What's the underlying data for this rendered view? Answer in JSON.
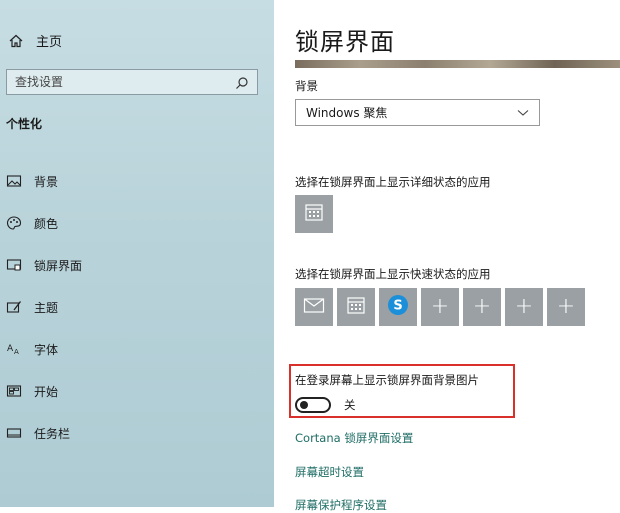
{
  "sidebar": {
    "home_label": "主页",
    "search_placeholder": "查找设置",
    "section_title": "个性化",
    "items": [
      {
        "label": "背景",
        "icon": "image-icon"
      },
      {
        "label": "颜色",
        "icon": "palette-icon"
      },
      {
        "label": "锁屏界面",
        "icon": "lock-screen-icon"
      },
      {
        "label": "主题",
        "icon": "theme-icon"
      },
      {
        "label": "字体",
        "icon": "font-icon"
      },
      {
        "label": "开始",
        "icon": "start-icon"
      },
      {
        "label": "任务栏",
        "icon": "taskbar-icon"
      }
    ]
  },
  "main": {
    "title": "锁屏界面",
    "background_label": "背景",
    "background_value": "Windows 聚焦",
    "detail_app_label": "选择在锁屏界面上显示详细状态的应用",
    "quick_app_label": "选择在锁屏界面上显示快速状态的应用",
    "quick_apps": [
      "mail-icon",
      "calendar-icon",
      "skype-icon",
      "plus-icon",
      "plus-icon",
      "plus-icon",
      "plus-icon"
    ],
    "signin_bg_label": "在登录屏幕上显示锁屏界面背景图片",
    "signin_bg_state": "关",
    "links": {
      "cortana": "Cortana 锁屏界面设置",
      "timeout": "屏幕超时设置",
      "screensaver": "屏幕保护程序设置"
    }
  },
  "colors": {
    "sidebar_bg": "#b9d3da",
    "tile_bg": "#9aa0a3",
    "link": "#1f6e66",
    "highlight": "#d9302c",
    "skype": "#1b8fd9"
  }
}
